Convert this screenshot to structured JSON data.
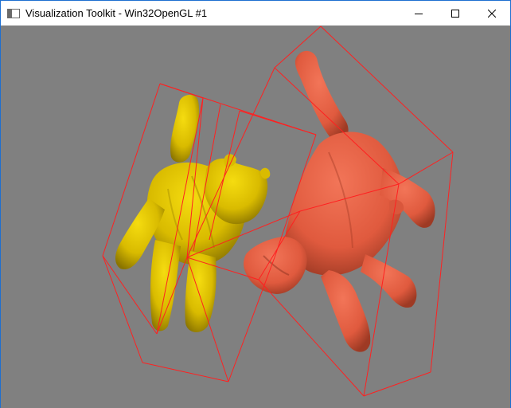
{
  "window": {
    "title": "Visualization Toolkit - Win32OpenGL #1"
  },
  "controls": {
    "minimize_icon": "minimize-icon",
    "maximize_icon": "maximize-icon",
    "close_icon": "close-icon"
  },
  "scene": {
    "background": "#808080",
    "outline_color": "#ff2020",
    "actors": [
      {
        "name": "cow-yellow",
        "color": "#e6c800"
      },
      {
        "name": "cow-coral",
        "color": "#ec6446"
      }
    ]
  }
}
